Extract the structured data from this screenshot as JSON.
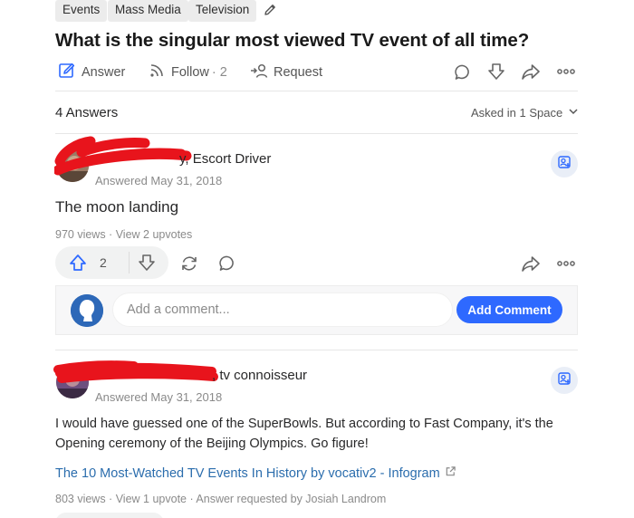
{
  "topics": [
    "Events",
    "Mass Media",
    "Television"
  ],
  "question": {
    "title": "What is the singular most viewed TV event of all time?",
    "actions": {
      "answer_label": "Answer",
      "follow_label": "Follow",
      "follow_count": "· 2",
      "request_label": "Request"
    }
  },
  "answers_header": {
    "count_label": "4 Answers",
    "asked_in_label": "Asked in 1 Space"
  },
  "answers": [
    {
      "author_credential": "y, Escort Driver",
      "answered_date": "Answered May 31, 2018",
      "text": "The moon landing",
      "meta": "970 views · View 2 upvotes",
      "upvotes": "2"
    },
    {
      "author_credential": ", tv connoisseur",
      "answered_date": "Answered May 31, 2018",
      "text_line1": "I would have guessed one of the SuperBowls. But according to Fast Company, it's the",
      "text_line2": "Opening ceremony of the Beijing Olympics. Go figure!",
      "link_text": "The 10 Most-Watched TV Events In History by vocativ2 - Infogram",
      "meta": "803 views · View 1 upvote · Answer requested by Josiah Landrom"
    }
  ],
  "comment": {
    "placeholder": "Add a comment...",
    "button_label": "Add Comment"
  },
  "colors": {
    "accent": "#2e69ff",
    "link": "#2b6dad",
    "redaction": "#e8141c"
  }
}
